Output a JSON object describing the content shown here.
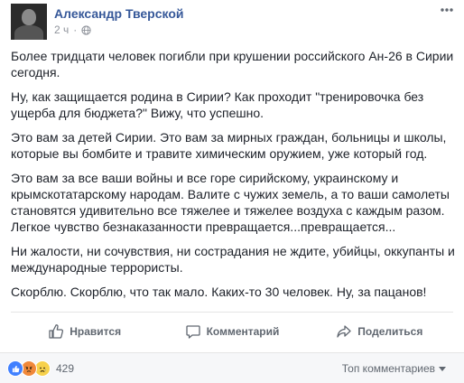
{
  "post": {
    "author": "Александр Тверской",
    "time": "2 ч",
    "separator": "·",
    "paragraphs": [
      "Более тридцати человек погибли при крушении российского Ан-26 в Сирии сегодня.",
      "Ну, как защищается родина в Сирии? Как проходит \"тренировочка без ущерба для бюджета?\" Вижу, что успешно.",
      "Это вам за детей Сирии. Это вам за мирных граждан, больницы и школы, которые вы бомбите и травите химическим оружием, уже который год.",
      "Это вам за все ваши войны и все горе сирийскому, украинскому и крымскотатарскому народам. Валите с чужих земель, а то ваши самолеты становятся удивительно все тяжелее и тяжелее воздуха с каждым разом. Легкое чувство безнаказанности превращается...превращается...",
      "Ни жалости, ни сочувствия, ни сострадания не ждите, убийцы, оккупанты и международные террористы.",
      "Скорблю. Скорблю, что так мало. Каких-то 30 человек. Ну, за пацанов!"
    ]
  },
  "actions": {
    "like": "Нравится",
    "comment": "Комментарий",
    "share": "Поделиться"
  },
  "footer": {
    "reaction_icons": [
      "like-icon",
      "angry-icon",
      "sad-icon"
    ],
    "reaction_count": "429",
    "sort_label": "Топ комментариев"
  },
  "colors": {
    "author_link": "#365899",
    "like_blue": "#4080ff",
    "text": "#1d2129",
    "muted": "#90949c"
  }
}
